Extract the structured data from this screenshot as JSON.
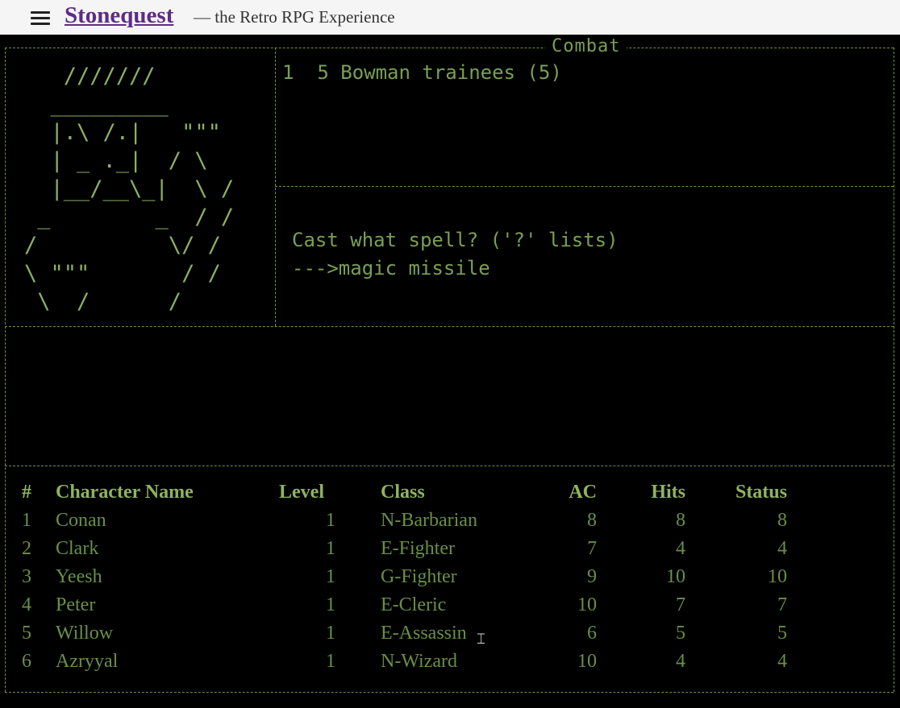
{
  "header": {
    "menu_icon": "hamburger-menu-icon",
    "title": "Stonequest",
    "subtitle": "— the Retro RPG Experience"
  },
  "screen": {
    "frame_title": "Combat",
    "art": "   ///////\n  _________\n  |.\\ /.|   \"\"\"\n  | _ ._|  / \\\n  |__/__\\_|  \\ /\n _        _  / /\n/          \\/ /\n\\ \"\"\"       / /\n \\  /      /",
    "encounter": "1  5 Bowman trainees (5)",
    "prompt": "Cast what spell? ('?' lists)",
    "input": "--->magic missile"
  },
  "party": {
    "headers": [
      "#",
      "Character Name",
      "Level",
      "Class",
      "AC",
      "Hits",
      "Status"
    ],
    "rows": [
      [
        "1",
        "Conan",
        "1",
        "N-Barbarian",
        "8",
        "8",
        "8"
      ],
      [
        "2",
        "Clark",
        "1",
        "E-Fighter",
        "7",
        "4",
        "4"
      ],
      [
        "3",
        "Yeesh",
        "1",
        "G-Fighter",
        "9",
        "10",
        "10"
      ],
      [
        "4",
        "Peter",
        "1",
        "E-Cleric",
        "10",
        "7",
        "7"
      ],
      [
        "5",
        "Willow",
        "1",
        "E-Assassin",
        "6",
        "5",
        "5"
      ],
      [
        "6",
        "Azryyal",
        "1",
        "N-Wizard",
        "10",
        "4",
        "4"
      ]
    ]
  },
  "colors": {
    "frame": "#6d9146",
    "text": "#6f9a4a",
    "header": "#8fb35f",
    "title_link": "#5b2d86"
  }
}
